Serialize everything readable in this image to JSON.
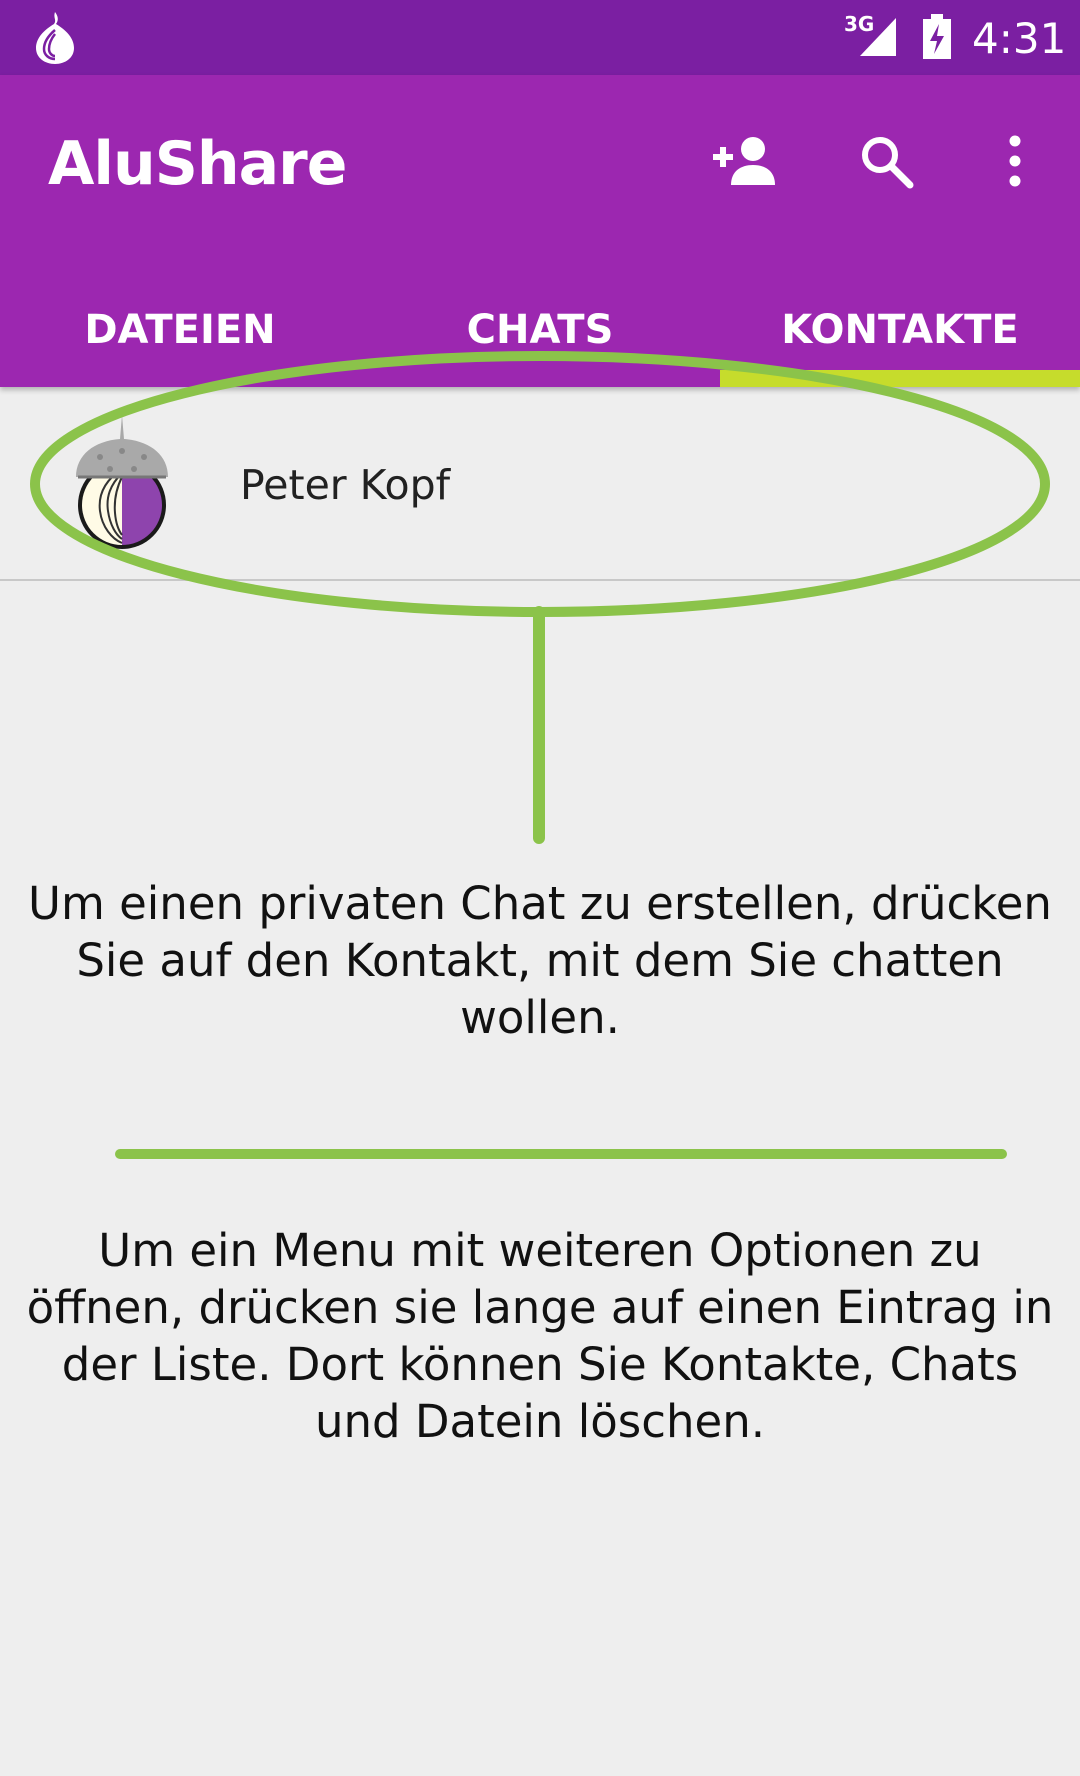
{
  "status_bar": {
    "network_type": "3G",
    "time": "4:31",
    "icons": [
      "tor-onion-icon",
      "cell-signal-icon",
      "battery-charging-icon"
    ]
  },
  "app_bar": {
    "title": "AluShare",
    "actions": [
      "add-contact-icon",
      "search-icon",
      "more-options-icon"
    ],
    "background_color": "#9c27b0",
    "status_color": "#7b1fa2"
  },
  "tabs": [
    {
      "label": "DATEIEN",
      "active": false
    },
    {
      "label": "CHATS",
      "active": false
    },
    {
      "label": "KONTAKTE",
      "active": true
    }
  ],
  "tab_indicator_color": "#c6dc2c",
  "contacts": [
    {
      "name": "Peter Kopf",
      "avatar": "tor-onion-acorn-avatar"
    }
  ],
  "overlay": {
    "highlight_color": "#8bc34a",
    "hint_contact": "Um einen privaten Chat zu erstellen, drücken Sie auf den Kontakt, mit dem Sie chatten wollen.",
    "hint_menu": "Um ein Menu mit weiteren Optionen zu öffnen, drücken sie lange auf einen Eintrag in der Liste. Dort können Sie Kontakte, Chats und Datein löschen."
  }
}
